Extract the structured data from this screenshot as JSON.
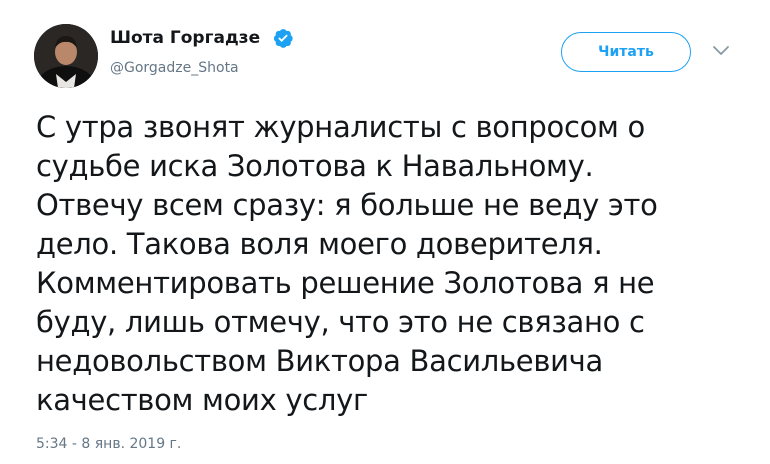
{
  "author": {
    "display_name": "Шота Горгадзе",
    "handle": "@Gorgadze_Shota",
    "verified": true
  },
  "follow_button": {
    "label": "Читать"
  },
  "tweet": {
    "lines": [
      "С утра звонят журналисты с вопросом о",
      "судьбе иска Золотова к Навальному.",
      "Отвечу всем сразу: я больше не веду это",
      "дело. Такова воля моего доверителя.",
      "Комментировать решение Золотова я не",
      "буду, лишь отмечу, что это не связано с",
      "недовольством Виктора Васильевича",
      "качеством моих услуг"
    ],
    "timestamp": "5:34 - 8 янв. 2019 г."
  },
  "icons": {
    "verified": "verified-badge-icon",
    "menu": "chevron-down-icon"
  },
  "colors": {
    "accent": "#1da1f2",
    "text": "#14171a",
    "muted": "#657786"
  }
}
